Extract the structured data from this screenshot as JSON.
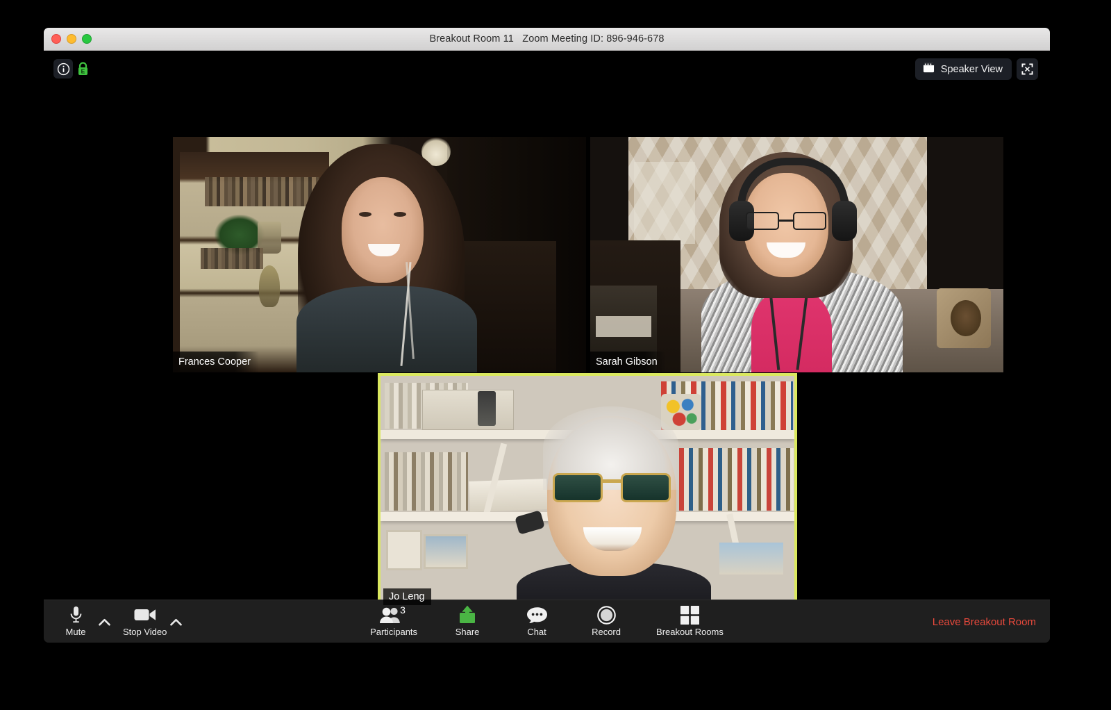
{
  "window": {
    "title": "Breakout Room 11   Zoom Meeting ID: 896-946-678",
    "traffic_lights": [
      "close",
      "minimize",
      "maximize"
    ]
  },
  "overlay": {
    "info_icon": "info-icon",
    "encryption_icon": "lock-shield-icon",
    "view_button": {
      "label": "Speaker View",
      "icon": "speaker-view-icon"
    },
    "fullscreen_button": {
      "icon": "fullscreen-icon"
    }
  },
  "participants": [
    {
      "name": "Frances Cooper",
      "active_speaker": false,
      "position": "top-left"
    },
    {
      "name": "Sarah Gibson",
      "active_speaker": false,
      "position": "top-right"
    },
    {
      "name": "Jo Leng",
      "active_speaker": true,
      "position": "bottom-center"
    }
  ],
  "toolbar": {
    "mute": {
      "label": "Mute",
      "icon": "microphone-icon",
      "chevron": "chevron-up-icon"
    },
    "video": {
      "label": "Stop Video",
      "icon": "video-camera-icon",
      "chevron": "chevron-up-icon"
    },
    "participants": {
      "label": "Participants",
      "icon": "participants-icon",
      "count": "3"
    },
    "share": {
      "label": "Share",
      "icon": "share-screen-icon"
    },
    "chat": {
      "label": "Chat",
      "icon": "chat-bubble-icon"
    },
    "record": {
      "label": "Record",
      "icon": "record-circle-icon"
    },
    "breakout": {
      "label": "Breakout Rooms",
      "icon": "breakout-rooms-grid-icon"
    },
    "leave": {
      "label": "Leave Breakout Room"
    }
  },
  "colors": {
    "active_speaker_border": "#dae85f",
    "share_green": "#4ab544",
    "leave_red": "#e8493c",
    "toolbar_bg": "#1f1f1f",
    "stage_bg": "#000000",
    "encryption_green": "#3fc23f"
  }
}
